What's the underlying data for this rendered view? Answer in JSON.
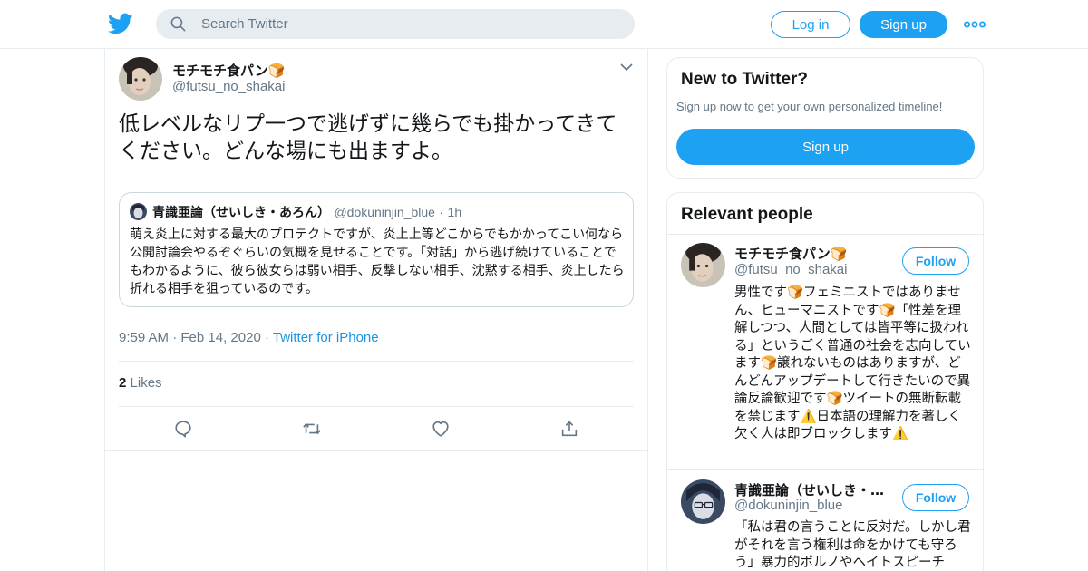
{
  "header": {
    "search_placeholder": "Search Twitter",
    "login_label": "Log in",
    "signup_label": "Sign up",
    "more_icon": "more-dots-icon"
  },
  "tweet": {
    "author_name": "モチモチ食パン🍞",
    "author_handle": "@futsu_no_shakai",
    "text": "低レベルなリプ一つで逃げずに幾らでも掛かってきてください。どんな場にも出ますよ。",
    "quoted": {
      "author_name": "青識亜論（せいしき・あろん）",
      "author_handle": "@dokuninjin_blue",
      "dot": "·",
      "time": "1h",
      "text": "萌え炎上に対する最大のプロテクトですが、炎上上等どこからでもかかってこい何なら公開討論会やるぞぐらいの気概を見せることです。「対話」から逃げ続けていることでもわかるように、彼ら彼女らは弱い相手、反撃しない相手、沈黙する相手、炎上したら折れる相手を狙っているのです。"
    },
    "time": "9:59 AM",
    "dot": "·",
    "date": "Feb 14, 2020",
    "source": "Twitter for iPhone",
    "likes_count": "2",
    "likes_label": "Likes",
    "actions": [
      "reply-icon",
      "retweet-icon",
      "like-icon",
      "share-icon"
    ]
  },
  "new_to_twitter": {
    "title": "New to Twitter?",
    "subtitle": "Sign up now to get your own personalized timeline!",
    "button_label": "Sign up"
  },
  "relevant_people": {
    "title": "Relevant people",
    "people": [
      {
        "name": "モチモチ食パン🍞",
        "handle": "@futsu_no_shakai",
        "follow_label": "Follow",
        "bio": "男性です🍞フェミニストではありません、ヒューマニストです🍞「性差を理解しつつ、人間としては皆平等に扱われる」というごく普通の社会を志向しています🍞譲れないものはありますが、どんどんアップデートして行きたいので異論反論歓迎です🍞ツイートの無断転載を禁じます⚠️日本語の理解力を著しく欠く人は即ブロックします⚠️"
      },
      {
        "name": "青識亜論（せいしき・…",
        "handle": "@dokuninjin_blue",
        "follow_label": "Follow",
        "bio": "「私は君の言うことに反対だ。しかし君がそれを言う権利は命をかけても守ろう」暴力的ポルノやヘイトスピーチ"
      }
    ]
  },
  "colors": {
    "brand": "#1da1f2",
    "link": "#1b95e0",
    "secondary_text": "#657786",
    "border": "#e6ecf0"
  }
}
